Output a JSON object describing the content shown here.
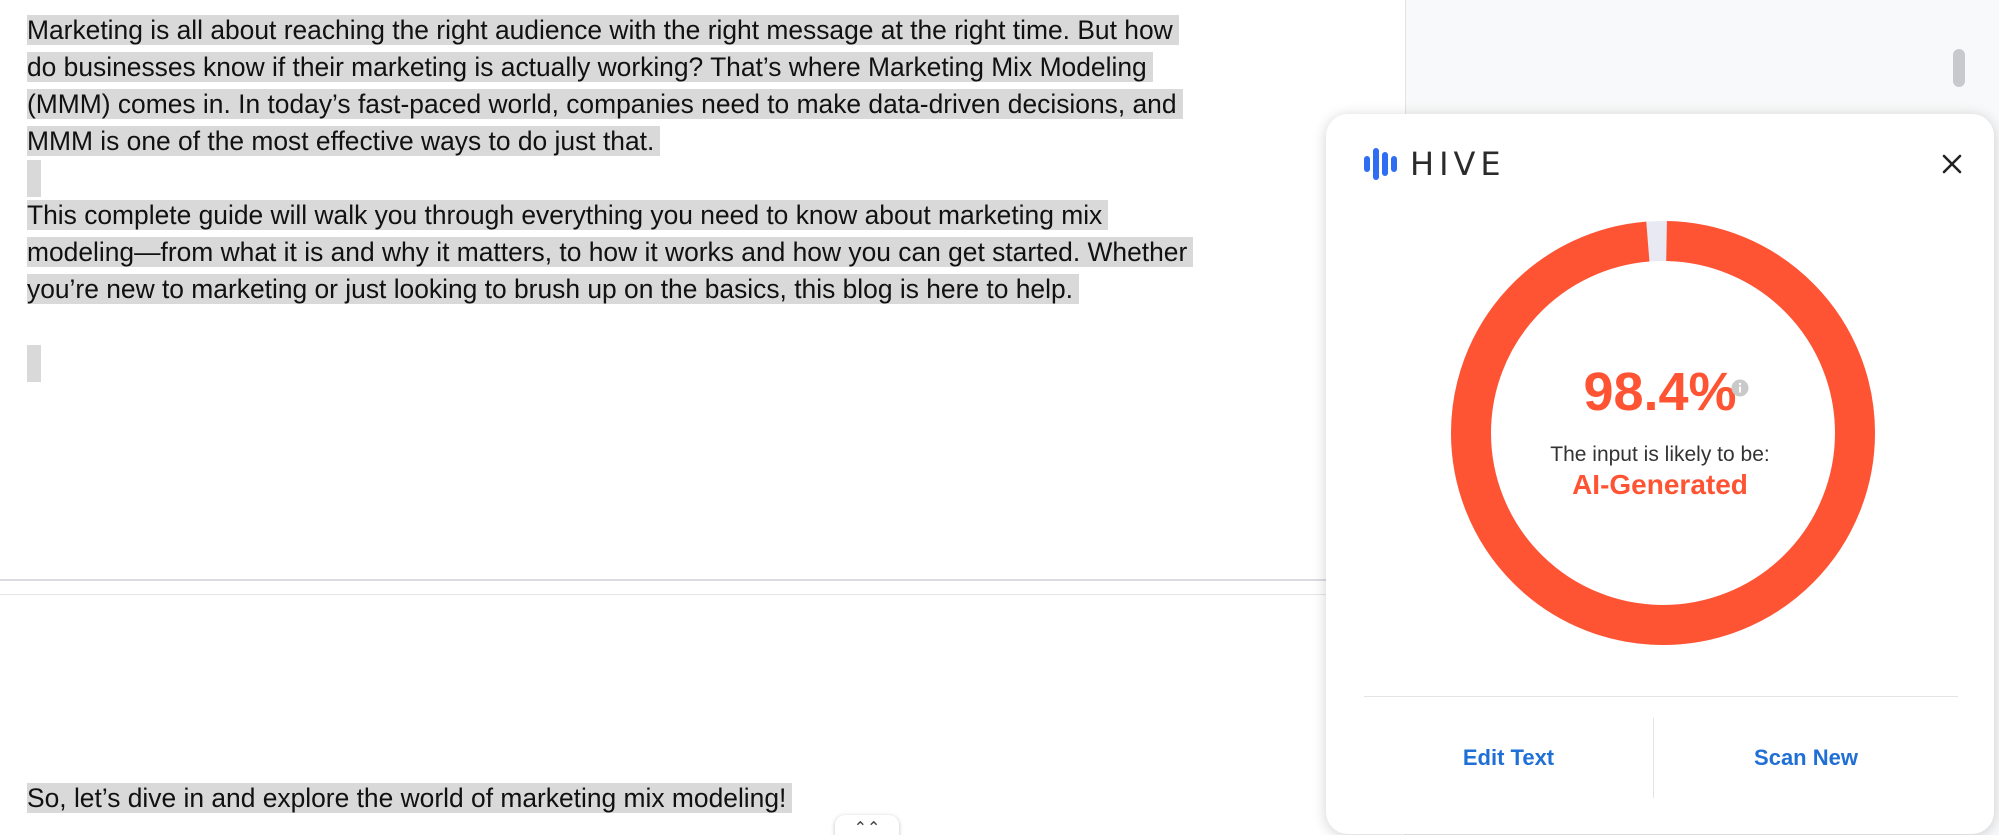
{
  "document": {
    "paragraph_1": "Marketing is all about reaching the right audience with the right message at the right time. But how do businesses know if their marketing is actually working? That’s where Marketing Mix Modeling (MMM) comes in. In today’s fast-paced world, companies need to make data-driven decisions, and MMM is one of the most effective ways to do just that.",
    "paragraph_2": "This complete guide will walk you through everything you need to know about marketing mix modeling—from what it is and why it matters, to how it works and how you can get started. Whether you’re new to marketing or just looking to brush up on the basics, this blog is here to help.",
    "paragraph_3": "So, let’s dive in and explore the world of marketing mix modeling!"
  },
  "hive_panel": {
    "brand": "HIVE",
    "score": "98.4%",
    "score_fraction": 0.984,
    "likely_label": "The input is likely to be:",
    "verdict": "AI-Generated",
    "edit_button": "Edit Text",
    "scan_button": "Scan New",
    "colors": {
      "accent": "#ff5433",
      "remainder": "#e8e9f3",
      "button_text": "#1f6fd6",
      "logo": "#2f6ef2"
    },
    "icons": {
      "logo": "hive-bars-icon",
      "close": "close-icon",
      "info": "info-icon"
    }
  }
}
